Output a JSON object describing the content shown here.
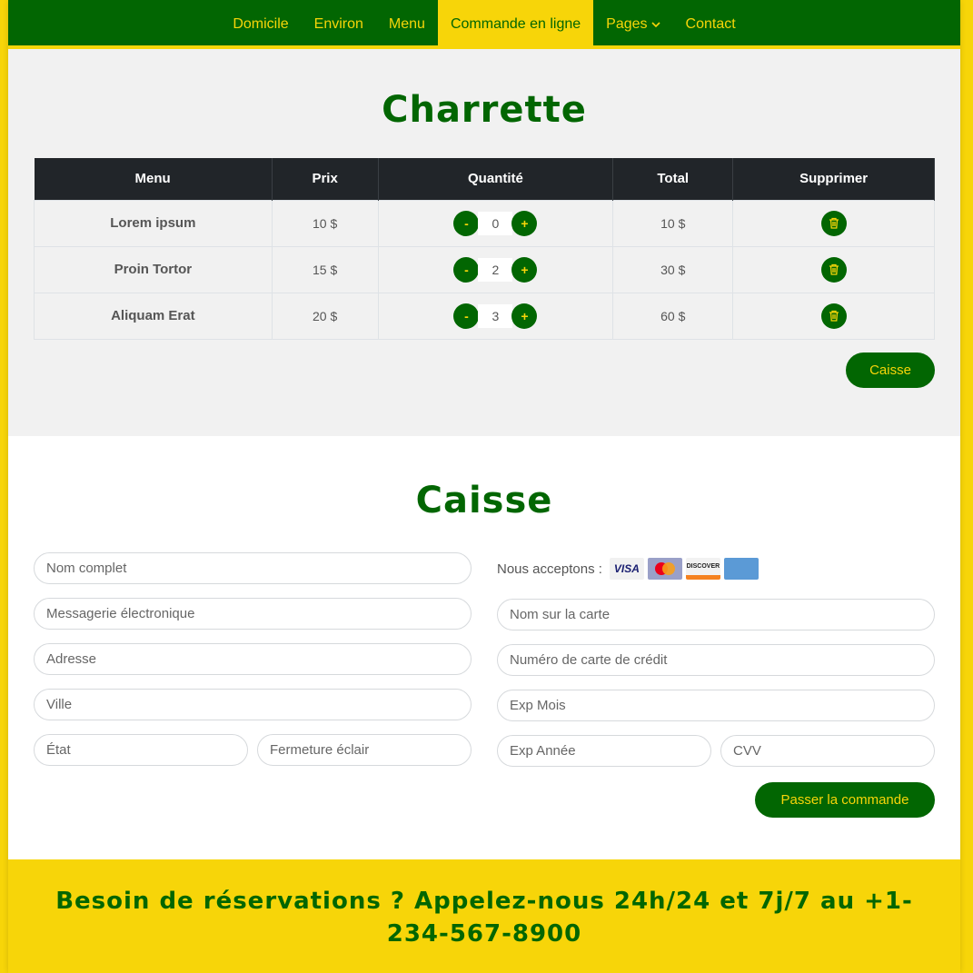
{
  "nav": {
    "items": [
      "Domicile",
      "Environ",
      "Menu",
      "Commande en ligne",
      "Pages",
      "Contact"
    ],
    "active_index": 3
  },
  "cart": {
    "title": "Charrette",
    "headers": [
      "Menu",
      "Prix",
      "Quantité",
      "Total",
      "Supprimer"
    ],
    "rows": [
      {
        "name": "Lorem ipsum",
        "price": "10 $",
        "qty": "0",
        "total": "10 $"
      },
      {
        "name": "Proin Tortor",
        "price": "15 $",
        "qty": "2",
        "total": "30 $"
      },
      {
        "name": "Aliquam Erat",
        "price": "20 $",
        "qty": "3",
        "total": "60 $"
      }
    ],
    "minus": "-",
    "plus": "+",
    "checkout_button": "Caisse"
  },
  "checkout": {
    "title": "Caisse",
    "left_fields": {
      "full_name": "Nom complet",
      "email": "Messagerie électronique",
      "address": "Adresse",
      "city": "Ville",
      "state": "État",
      "zip": "Fermeture éclair"
    },
    "accept_label": "Nous acceptons :",
    "cards": [
      "VISA",
      "MasterCard",
      "DISCOVER",
      "AMERICAN EXPRESS"
    ],
    "right_fields": {
      "card_name": "Nom sur la carte",
      "card_number": "Numéro de carte de crédit",
      "exp_month": "Exp Mois",
      "exp_year": "Exp Année",
      "cvv": "CVV"
    },
    "order_button": "Passer la commande"
  },
  "footer": {
    "text": "Besoin de réservations ? Appelez-nous 24h/24 et 7j/7 au +1-234-567-8900"
  },
  "colors": {
    "green": "#026602",
    "yellow": "#f7d509",
    "dark": "#212529"
  }
}
